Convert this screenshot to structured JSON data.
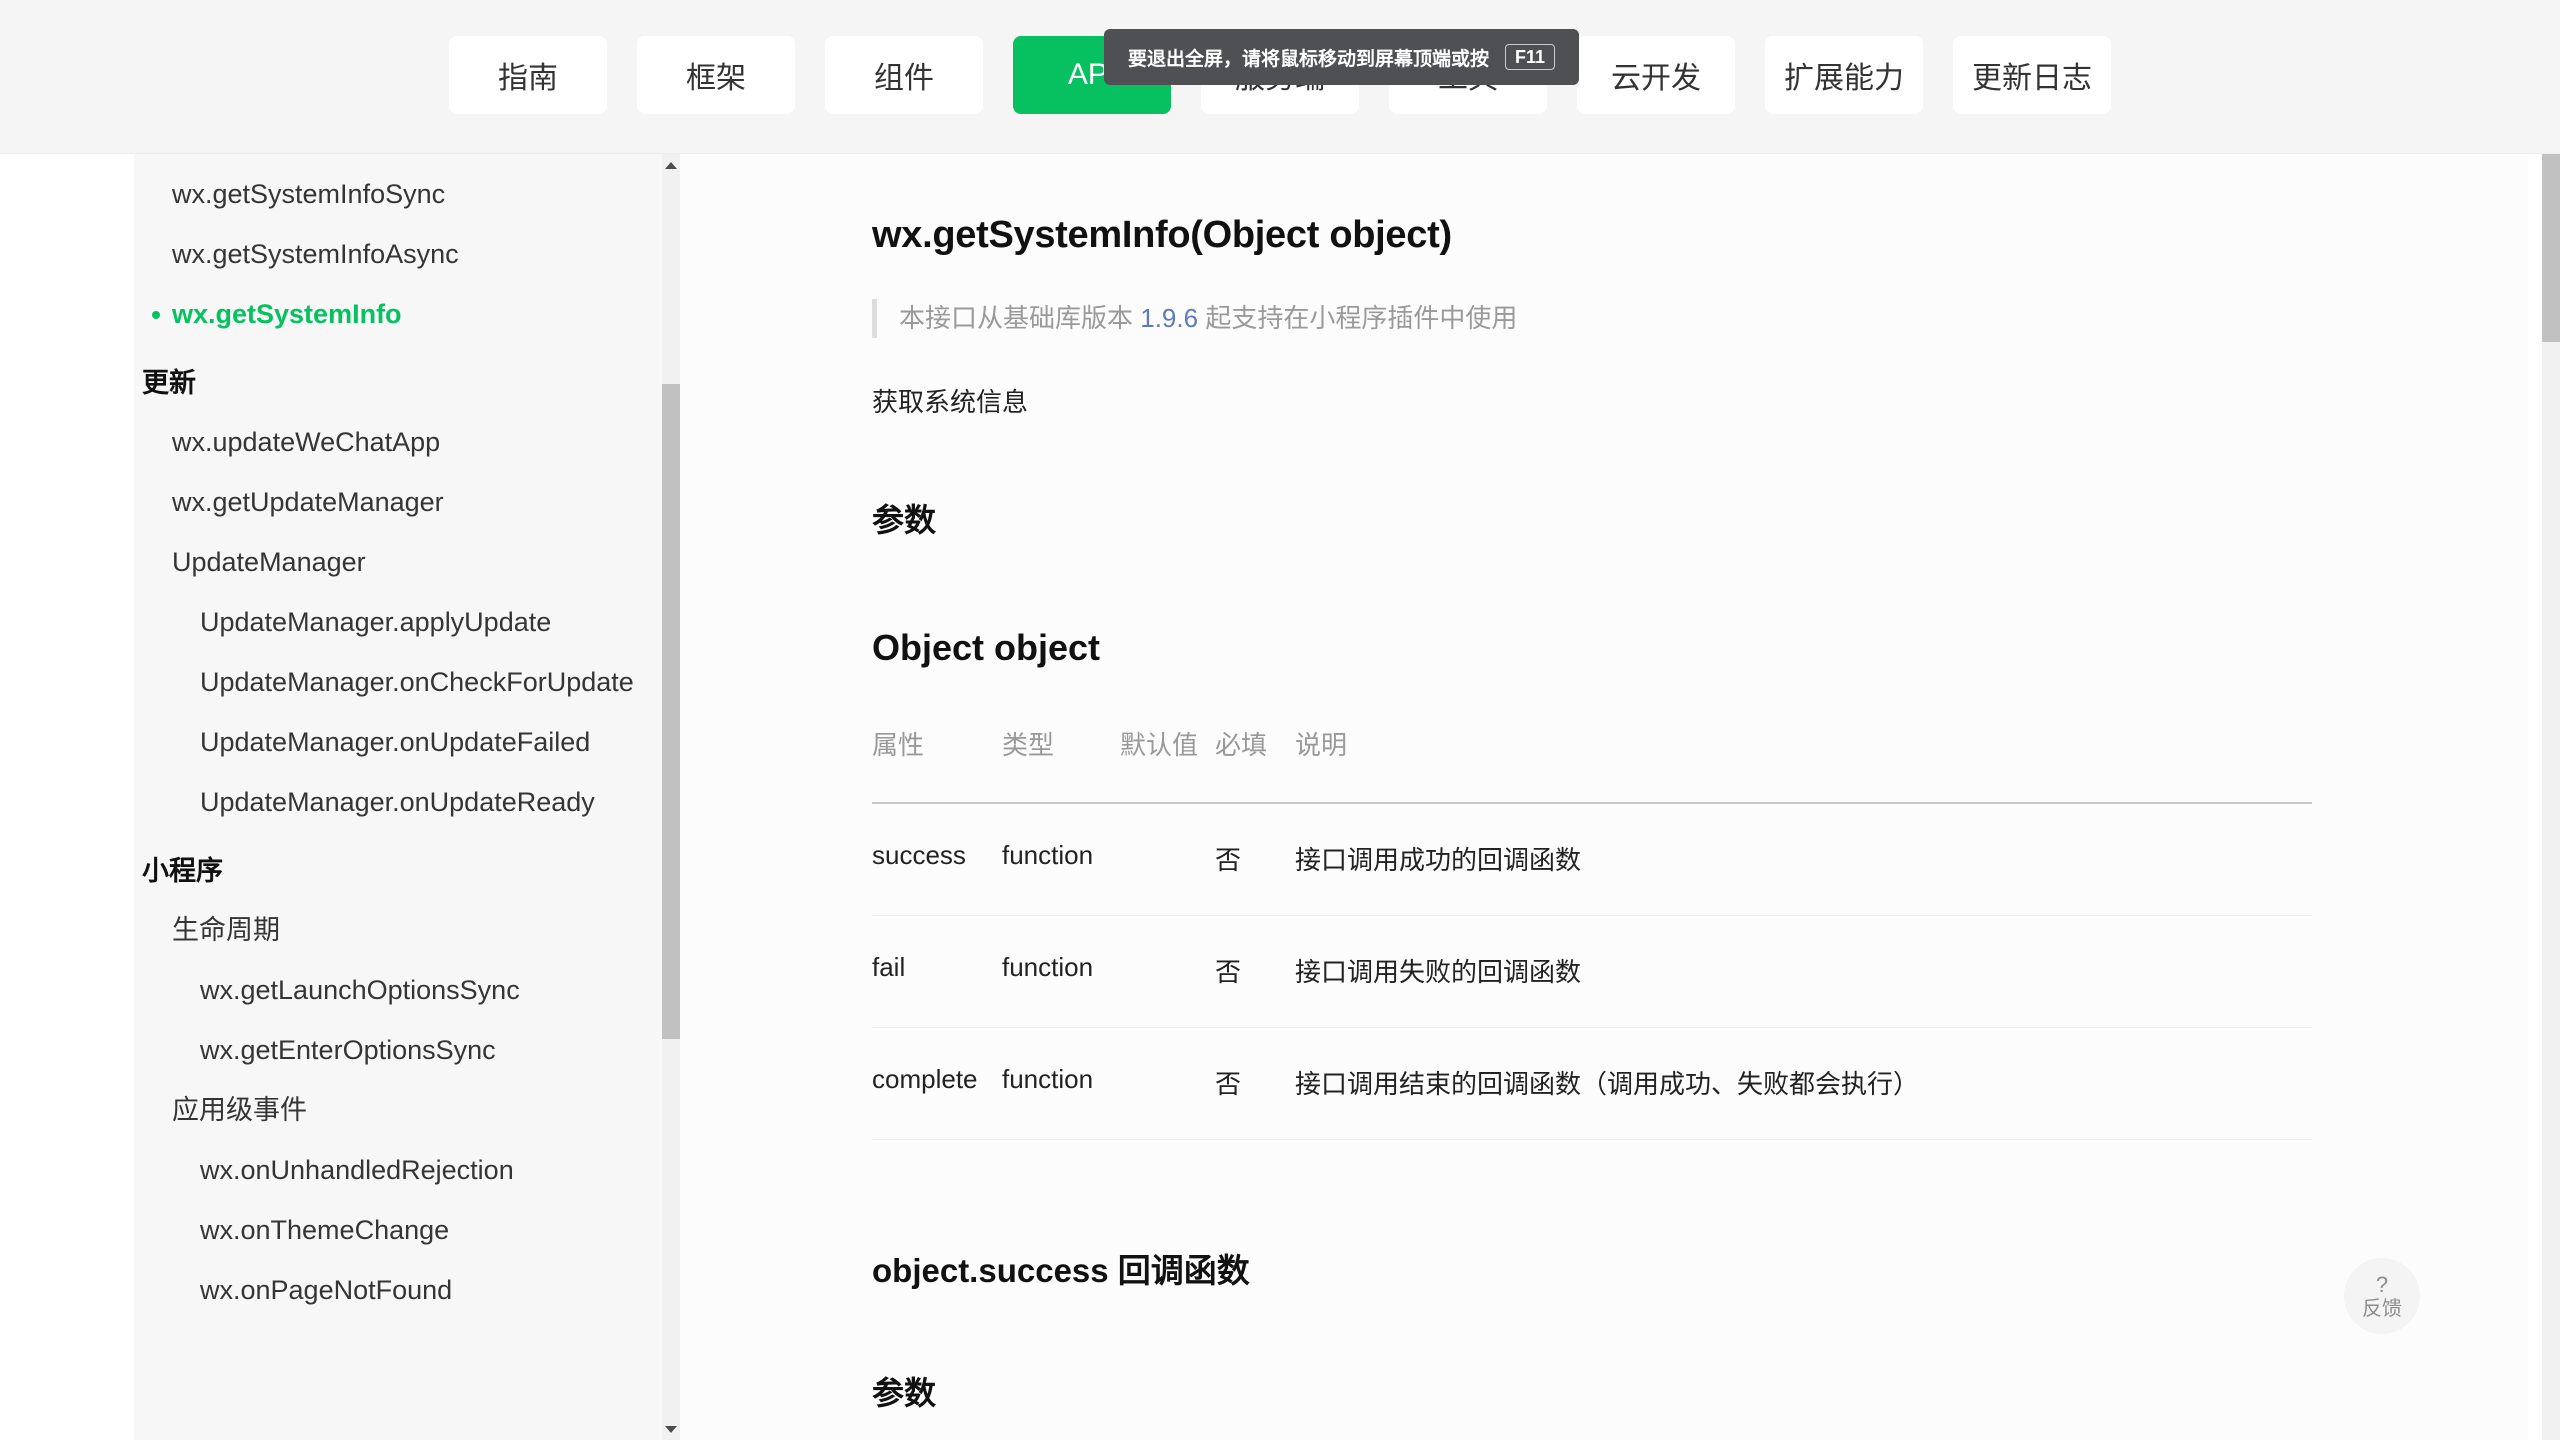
{
  "topnav": {
    "tabs": [
      {
        "label": "指南",
        "active": false
      },
      {
        "label": "框架",
        "active": false
      },
      {
        "label": "组件",
        "active": false
      },
      {
        "label": "API",
        "active": true
      },
      {
        "label": "服务端",
        "active": false
      },
      {
        "label": "工具",
        "active": false
      },
      {
        "label": "云开发",
        "active": false
      },
      {
        "label": "扩展能力",
        "active": false
      },
      {
        "label": "更新日志",
        "active": false
      }
    ],
    "accent_color": "#07c160",
    "bar_color": "#f5f5f5"
  },
  "fullscreen_hint": {
    "message": "要退出全屏，请将鼠标移动到屏幕顶端或按",
    "key": "F11",
    "background": "#4e5054"
  },
  "sidebar": {
    "items": [
      {
        "label": "wx.getSystemInfoSync",
        "level": 1,
        "active": false,
        "type": "item"
      },
      {
        "label": "wx.getSystemInfoAsync",
        "level": 1,
        "active": false,
        "type": "item"
      },
      {
        "label": "wx.getSystemInfo",
        "level": 1,
        "active": true,
        "type": "item"
      },
      {
        "label": "更新",
        "level": 0,
        "active": false,
        "type": "group"
      },
      {
        "label": "wx.updateWeChatApp",
        "level": 1,
        "active": false,
        "type": "item"
      },
      {
        "label": "wx.getUpdateManager",
        "level": 1,
        "active": false,
        "type": "item"
      },
      {
        "label": "UpdateManager",
        "level": 1,
        "active": false,
        "type": "item"
      },
      {
        "label": "UpdateManager.applyUpdate",
        "level": 2,
        "active": false,
        "type": "item"
      },
      {
        "label": "UpdateManager.onCheckForUpdate",
        "level": 2,
        "active": false,
        "type": "item"
      },
      {
        "label": "UpdateManager.onUpdateFailed",
        "level": 2,
        "active": false,
        "type": "item"
      },
      {
        "label": "UpdateManager.onUpdateReady",
        "level": 2,
        "active": false,
        "type": "item"
      },
      {
        "label": "小程序",
        "level": 0,
        "active": false,
        "type": "group"
      },
      {
        "label": "生命周期",
        "level": 1,
        "active": false,
        "type": "item"
      },
      {
        "label": "wx.getLaunchOptionsSync",
        "level": 2,
        "active": false,
        "type": "item"
      },
      {
        "label": "wx.getEnterOptionsSync",
        "level": 2,
        "active": false,
        "type": "item"
      },
      {
        "label": "应用级事件",
        "level": 1,
        "active": false,
        "type": "item"
      },
      {
        "label": "wx.onUnhandledRejection",
        "level": 2,
        "active": false,
        "type": "item"
      },
      {
        "label": "wx.onThemeChange",
        "level": 2,
        "active": false,
        "type": "item"
      },
      {
        "label": "wx.onPageNotFound",
        "level": 2,
        "active": false,
        "type": "item"
      }
    ],
    "active_color": "#07c160"
  },
  "main": {
    "title": "wx.getSystemInfo(Object object)",
    "note_prefix": "本接口从基础库版本",
    "note_version": "1.9.6",
    "note_suffix": "起支持在小程序插件中使用",
    "description": "获取系统信息",
    "section_params": "参数",
    "section_object": "Object object",
    "section_callback": "object.success 回调函数",
    "section_callback_params": "参数",
    "table": {
      "headers": [
        "属性",
        "类型",
        "默认值",
        "必填",
        "说明"
      ],
      "rows": [
        {
          "attr": "success",
          "type": "function",
          "default": "",
          "required": "否",
          "desc": "接口调用成功的回调函数"
        },
        {
          "attr": "fail",
          "type": "function",
          "default": "",
          "required": "否",
          "desc": "接口调用失败的回调函数"
        },
        {
          "attr": "complete",
          "type": "function",
          "default": "",
          "required": "否",
          "desc": "接口调用结束的回调函数（调用成功、失败都会执行）"
        }
      ]
    }
  },
  "feedback": {
    "icon": "question-mark-icon",
    "symbol": "?",
    "label": "反馈"
  }
}
